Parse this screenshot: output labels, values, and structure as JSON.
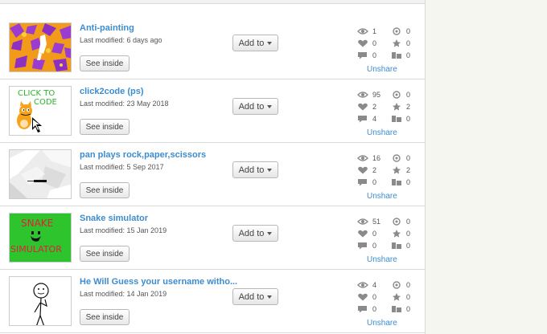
{
  "projects": [
    {
      "title": "Anti-painting",
      "modified": "Last modified: 6 days ago",
      "see_inside": "See inside",
      "add_to": "Add to",
      "views": "1",
      "loves": "0",
      "comments": "0",
      "remixes": "0",
      "favorites": "0",
      "studios": "0",
      "unshare": "Unshare",
      "thumb": "orange-purple-pattern"
    },
    {
      "title": "click2code (ps)",
      "modified": "Last modified: 23 May 2018",
      "see_inside": "See inside",
      "add_to": "Add to",
      "views": "95",
      "loves": "2",
      "comments": "4",
      "remixes": "0",
      "favorites": "2",
      "studios": "0",
      "unshare": "Unshare",
      "thumb": "scratch-cat-click-to-code",
      "thumb_text": [
        "CLICK TO",
        "CODE"
      ]
    },
    {
      "title": "pan plays rock,paper,scissors",
      "modified": "Last modified: 5 Sep 2017",
      "see_inside": "See inside",
      "add_to": "Add to",
      "views": "16",
      "loves": "2",
      "comments": "0",
      "remixes": "0",
      "favorites": "2",
      "studios": "0",
      "unshare": "Unshare",
      "thumb": "grey-shapes"
    },
    {
      "title": "Snake simulator",
      "modified": "Last modified: 15 Jan 2019",
      "see_inside": "See inside",
      "add_to": "Add to",
      "views": "51",
      "loves": "0",
      "comments": "0",
      "remixes": "0",
      "favorites": "0",
      "studios": "0",
      "unshare": "Unshare",
      "thumb": "snake-simulator",
      "thumb_text": [
        "SNAKE",
        "SIMULATOR"
      ]
    },
    {
      "title": "He Will Guess your username witho...",
      "modified": "Last modified: 14 Jan 2019",
      "see_inside": "See inside",
      "add_to": "Add to",
      "views": "4",
      "loves": "0",
      "comments": "0",
      "remixes": "0",
      "favorites": "0",
      "studios": "0",
      "unshare": "Unshare",
      "thumb": "stick-figure"
    }
  ],
  "icons": {
    "views": "eye-icon",
    "loves": "heart-icon",
    "comments": "comment-icon",
    "remixes": "remix-icon",
    "favorites": "star-icon",
    "studios": "studio-icon"
  },
  "colors": {
    "link": "#3d8ccf",
    "icon": "#8a8a8a",
    "border": "#d9d9d9"
  }
}
